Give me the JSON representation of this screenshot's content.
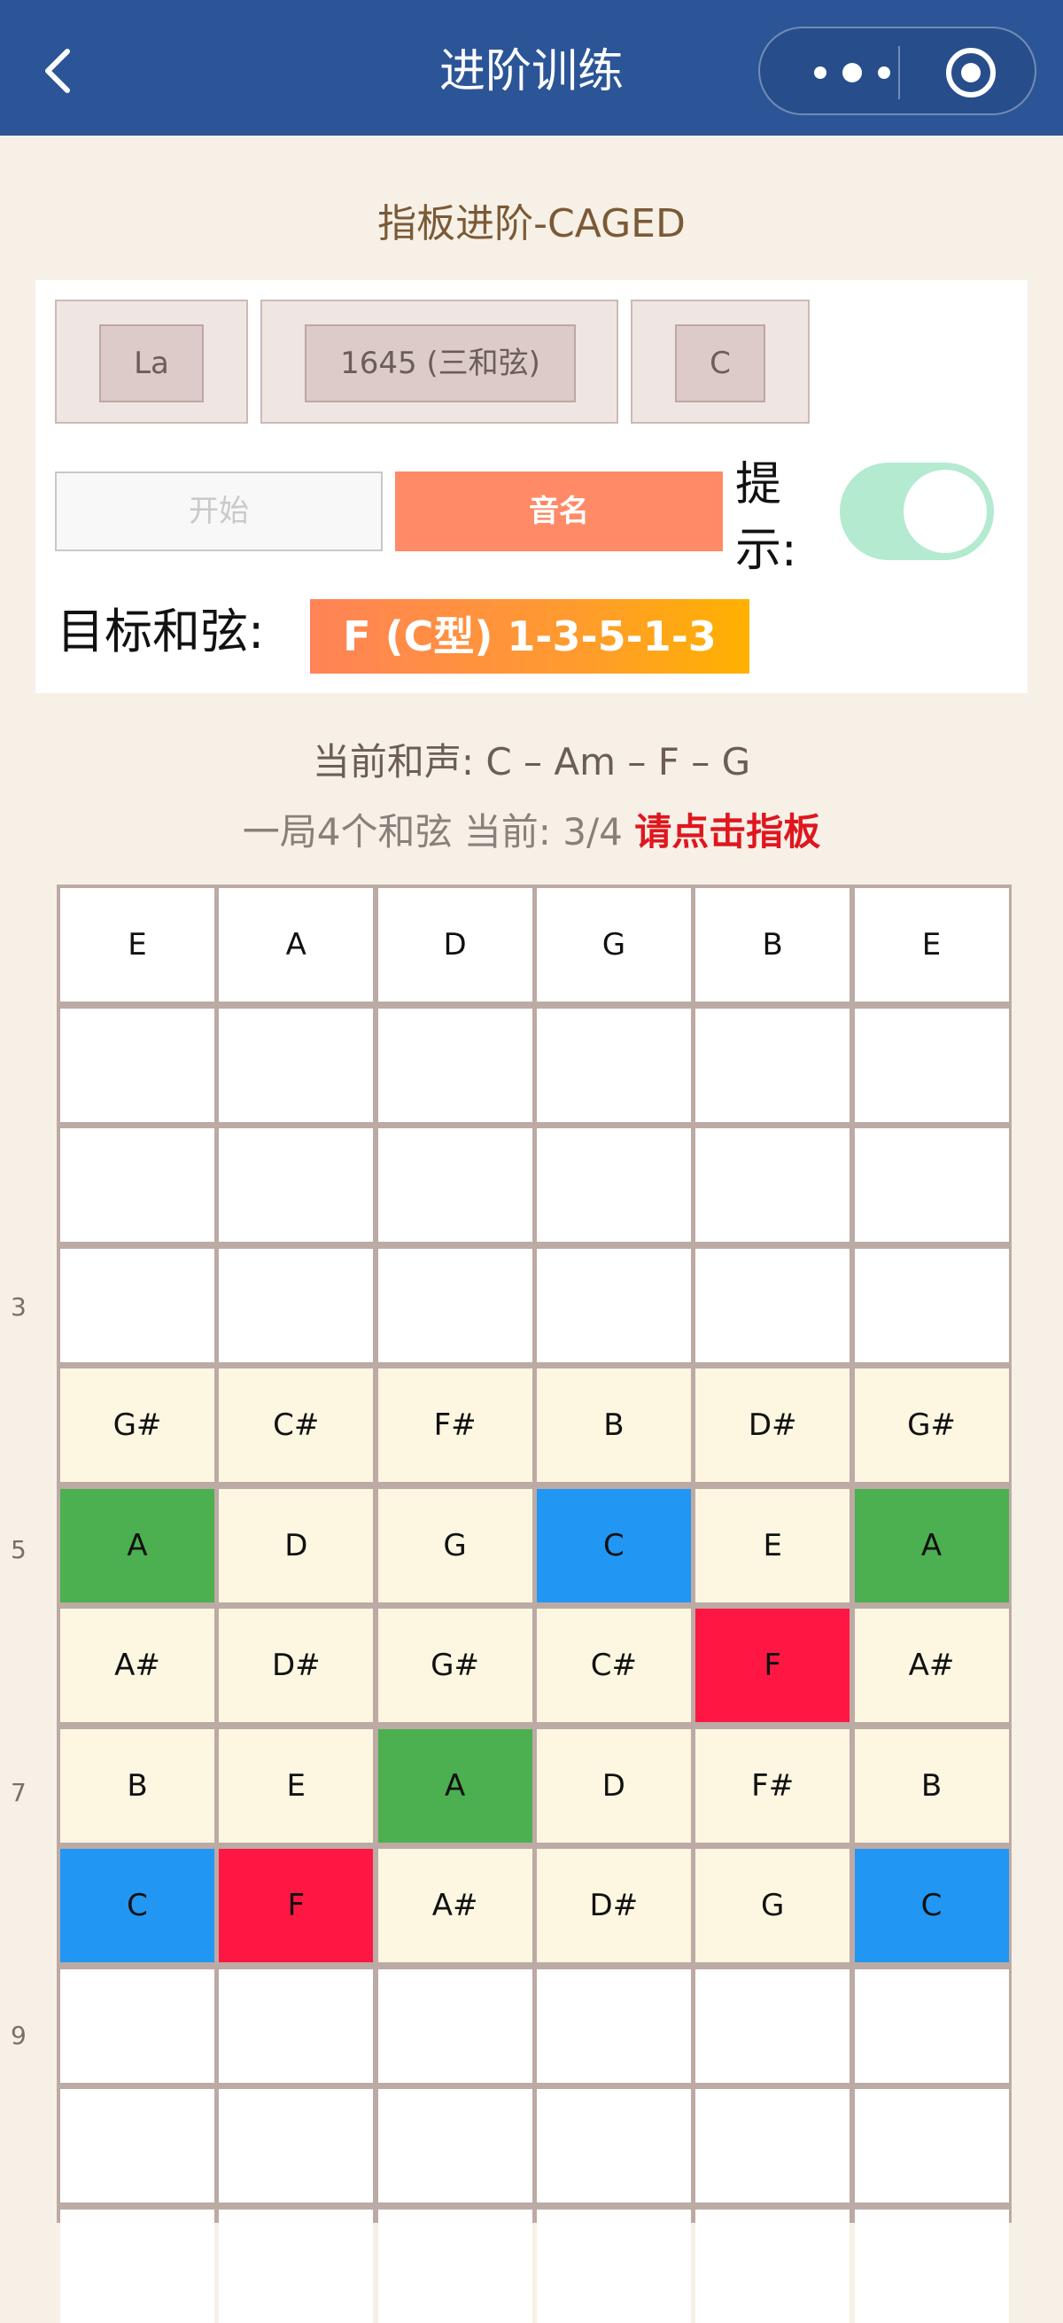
{
  "header": {
    "title": "进阶训练"
  },
  "page": {
    "subtitle": "指板进阶-CAGED"
  },
  "selectors": [
    {
      "value": "La"
    },
    {
      "value": "1645 (三和弦)"
    },
    {
      "value": "C"
    }
  ],
  "controls": {
    "start_label": "开始",
    "note_label": "音名",
    "hint_label": "提示:",
    "hint_enabled": true,
    "target_label": "目标和弦:",
    "target_value": "F (C型) 1-3-5-1-3"
  },
  "info": {
    "harmony": "当前和声: C – Am – F – G",
    "progress_text": "一局4个和弦 当前: 3/4",
    "progress_alert": "请点击指板"
  },
  "fret_numbers": [
    "3",
    "5",
    "7",
    "9"
  ],
  "fretboard": {
    "strings": [
      "E",
      "A",
      "D",
      "G",
      "B",
      "E"
    ],
    "rows": [
      [
        {
          "n": "",
          "s": "empty"
        },
        {
          "n": "",
          "s": "empty"
        },
        {
          "n": "",
          "s": "empty"
        },
        {
          "n": "",
          "s": "empty"
        },
        {
          "n": "",
          "s": "empty"
        },
        {
          "n": "",
          "s": "empty"
        }
      ],
      [
        {
          "n": "",
          "s": "empty"
        },
        {
          "n": "",
          "s": "empty"
        },
        {
          "n": "",
          "s": "empty"
        },
        {
          "n": "",
          "s": "empty"
        },
        {
          "n": "",
          "s": "empty"
        },
        {
          "n": "",
          "s": "empty"
        }
      ],
      [
        {
          "n": "",
          "s": "empty"
        },
        {
          "n": "",
          "s": "empty"
        },
        {
          "n": "",
          "s": "empty"
        },
        {
          "n": "",
          "s": "empty"
        },
        {
          "n": "",
          "s": "empty"
        },
        {
          "n": "",
          "s": "empty"
        }
      ],
      [
        {
          "n": "G#",
          "s": "cream"
        },
        {
          "n": "C#",
          "s": "cream"
        },
        {
          "n": "F#",
          "s": "cream"
        },
        {
          "n": "B",
          "s": "cream"
        },
        {
          "n": "D#",
          "s": "cream"
        },
        {
          "n": "G#",
          "s": "cream"
        }
      ],
      [
        {
          "n": "A",
          "s": "green"
        },
        {
          "n": "D",
          "s": "cream"
        },
        {
          "n": "G",
          "s": "cream"
        },
        {
          "n": "C",
          "s": "blue"
        },
        {
          "n": "E",
          "s": "cream"
        },
        {
          "n": "A",
          "s": "green"
        }
      ],
      [
        {
          "n": "A#",
          "s": "cream"
        },
        {
          "n": "D#",
          "s": "cream"
        },
        {
          "n": "G#",
          "s": "cream"
        },
        {
          "n": "C#",
          "s": "cream"
        },
        {
          "n": "F",
          "s": "red"
        },
        {
          "n": "A#",
          "s": "cream"
        }
      ],
      [
        {
          "n": "B",
          "s": "cream"
        },
        {
          "n": "E",
          "s": "cream"
        },
        {
          "n": "A",
          "s": "green"
        },
        {
          "n": "D",
          "s": "cream"
        },
        {
          "n": "F#",
          "s": "cream"
        },
        {
          "n": "B",
          "s": "cream"
        }
      ],
      [
        {
          "n": "C",
          "s": "blue"
        },
        {
          "n": "F",
          "s": "red"
        },
        {
          "n": "A#",
          "s": "cream"
        },
        {
          "n": "D#",
          "s": "cream"
        },
        {
          "n": "G",
          "s": "cream"
        },
        {
          "n": "C",
          "s": "blue"
        }
      ],
      [
        {
          "n": "",
          "s": "empty"
        },
        {
          "n": "",
          "s": "empty"
        },
        {
          "n": "",
          "s": "empty"
        },
        {
          "n": "",
          "s": "empty"
        },
        {
          "n": "",
          "s": "empty"
        },
        {
          "n": "",
          "s": "empty"
        }
      ],
      [
        {
          "n": "",
          "s": "empty"
        },
        {
          "n": "",
          "s": "empty"
        },
        {
          "n": "",
          "s": "empty"
        },
        {
          "n": "",
          "s": "empty"
        },
        {
          "n": "",
          "s": "empty"
        },
        {
          "n": "",
          "s": "empty"
        }
      ],
      [
        {
          "n": "",
          "s": "empty"
        },
        {
          "n": "",
          "s": "empty"
        },
        {
          "n": "",
          "s": "empty"
        },
        {
          "n": "",
          "s": "empty"
        },
        {
          "n": "",
          "s": "empty"
        },
        {
          "n": "",
          "s": "empty"
        }
      ]
    ]
  },
  "colors": {
    "header_bg": "#2b5597",
    "root_note": "#2196f3",
    "third_note": "#ff1744",
    "fifth_note": "#4caf50",
    "scale_note": "#fdf6e1",
    "toggle_on": "#b3ead0",
    "alert": "#e0161e"
  }
}
